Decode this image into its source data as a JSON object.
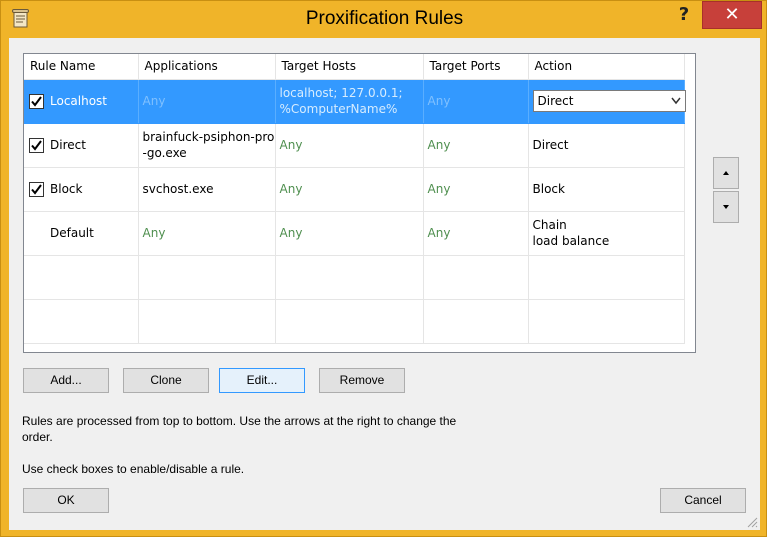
{
  "window": {
    "title": "Proxification Rules",
    "help_label": "?",
    "close_label": "✕"
  },
  "grid": {
    "columns": [
      "Rule Name",
      "Applications",
      "Target Hosts",
      "Target Ports",
      "Action"
    ],
    "rows": [
      {
        "checked": true,
        "name": "Localhost",
        "applications": "Any",
        "hosts_line1": "localhost; 127.0.0.1;",
        "hosts_line2": "%ComputerName%",
        "ports": "Any",
        "action": "Direct",
        "selected": true
      },
      {
        "checked": true,
        "name": "Direct",
        "applications_line1": "brainfuck-psiphon-pro",
        "applications_line2": "-go.exe",
        "hosts": "Any",
        "ports": "Any",
        "action": "Direct"
      },
      {
        "checked": true,
        "name": "Block",
        "applications": "svchost.exe",
        "hosts": "Any",
        "ports": "Any",
        "action": "Block"
      },
      {
        "checked": false,
        "name": "Default",
        "applications": "Any",
        "hosts": "Any",
        "ports": "Any",
        "action_line1": "Chain",
        "action_line2": "load balance"
      }
    ]
  },
  "buttons": {
    "add": "Add...",
    "clone": "Clone",
    "edit": "Edit...",
    "remove": "Remove",
    "ok": "OK",
    "cancel": "Cancel"
  },
  "info": {
    "line1": "Rules are processed from top to bottom. Use the arrows at the right to change the",
    "line2": "order.",
    "line3": "Use check boxes to enable/disable a rule."
  },
  "colors": {
    "title_bar": "#f0b429",
    "selection": "#3399ff",
    "any_text": "#4f8f4f",
    "close_button": "#c7403a"
  }
}
